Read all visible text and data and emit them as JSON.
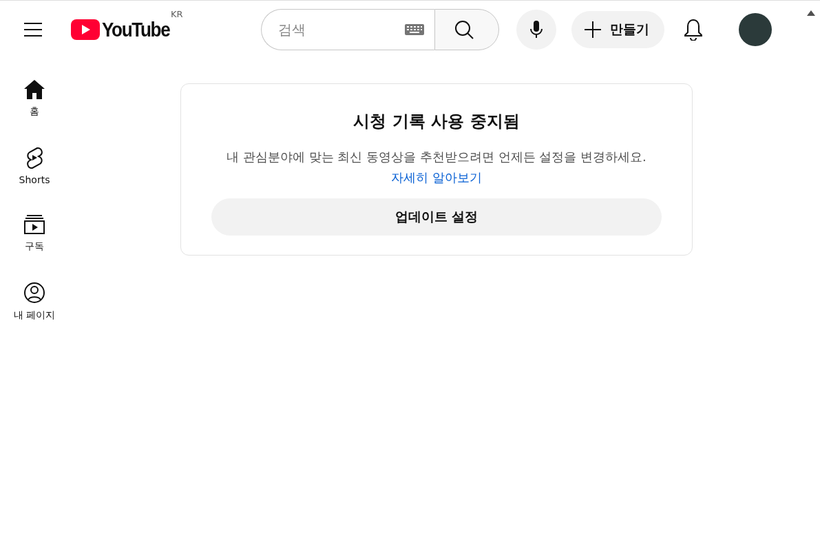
{
  "header": {
    "logo_text": "YouTube",
    "country": "KR",
    "search": {
      "placeholder": "검색"
    },
    "create_button": "만들기"
  },
  "sidebar": {
    "items": [
      {
        "kind": "home",
        "label": "홈"
      },
      {
        "kind": "shorts",
        "label": "Shorts"
      },
      {
        "kind": "subscriptions",
        "label": "구독"
      },
      {
        "kind": "you",
        "label": "내 페이지"
      }
    ]
  },
  "notice": {
    "title": "시청 기록 사용 중지됨",
    "message": "내 관심분야에 맞는 최신 동영상을 추천받으려면 언제든 설정을 변경하세요.",
    "link": "자세히 알아보기",
    "button": "업데이트 설정"
  }
}
